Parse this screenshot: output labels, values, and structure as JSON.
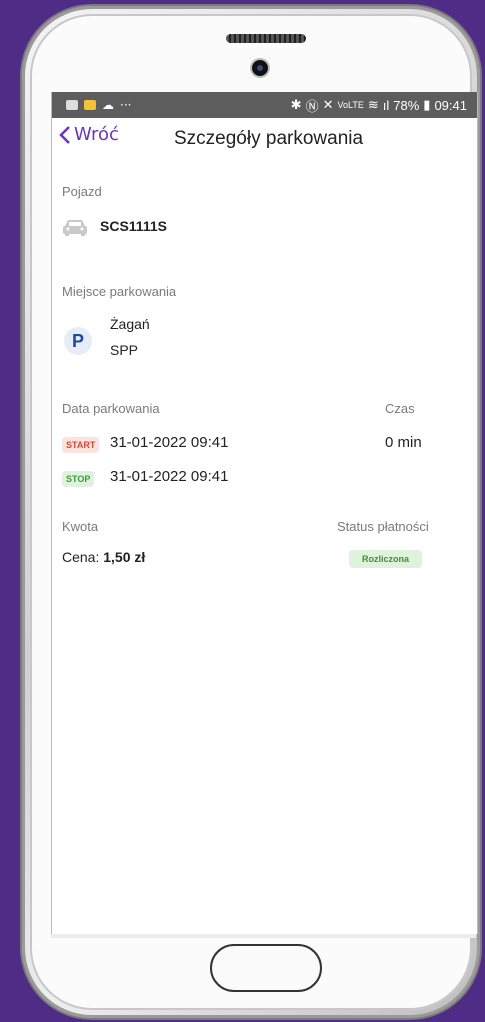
{
  "status_bar": {
    "dots": "···",
    "right": "✱ N ✕ Vo) ≋ .ıl 78%",
    "battery": "78%",
    "time": "09:41"
  },
  "header": {
    "back_label": "Wróć",
    "title": "Szczegóły parkowania"
  },
  "vehicle": {
    "label": "Pojazd",
    "plate": "SCS1111S",
    "icon": "car-icon"
  },
  "place": {
    "label": "Miejsce parkowania",
    "city": "Żagań",
    "zone": "SPP",
    "icon": "parking-icon"
  },
  "dates": {
    "label": "Data parkowania",
    "time_label": "Czas",
    "start_tag": "START",
    "start_value": "31-01-2022 09:41",
    "duration": "0 min",
    "stop_tag": "STOP",
    "stop_value": "31-01-2022 09:41"
  },
  "payment": {
    "amount_label": "Kwota",
    "price_prefix": "Cena: ",
    "price_value": "1,50 zł",
    "status_label": "Status płatności",
    "status_value": "Rozliczona"
  },
  "colors": {
    "accent": "#6a37b8",
    "background": "#4f2d86",
    "start": "#d24a35",
    "stop": "#3f9a3a"
  }
}
